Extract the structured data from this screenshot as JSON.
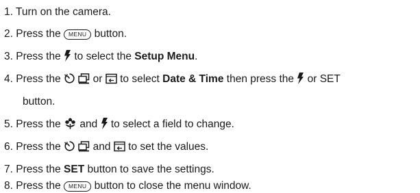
{
  "steps": [
    {
      "num": "1.",
      "text": "Turn on the camera."
    },
    {
      "num": "2.",
      "pre": "Press the",
      "key": "MENU",
      "post": "button."
    },
    {
      "num": "3.",
      "pre": "Press the",
      "mid": "to select the",
      "bold": "Setup Menu",
      "end": "."
    },
    {
      "num": "4.",
      "pre": "Press the",
      "or1": "or",
      "mid": "to select",
      "bold": "Date & Time",
      "then": "then press the",
      "or2": "or SET",
      "cont": "button."
    },
    {
      "num": "5.",
      "pre": "Press the",
      "and": "and",
      "post": "to select a field to change."
    },
    {
      "num": "6.",
      "pre": "Press the",
      "and": "and",
      "post": "to set the values."
    },
    {
      "num": "7.",
      "pre": "Press the",
      "bold": "SET",
      "post": "button to save the settings."
    },
    {
      "num": "8.",
      "pre": "Press the",
      "key": "MENU",
      "post": "button to close the menu window."
    }
  ],
  "icons": {
    "flash": "flash-icon",
    "selftimer": "self-timer-icon",
    "continuous": "continuous-shot-icon",
    "playback": "playback-icon",
    "macro": "macro-flower-icon"
  }
}
